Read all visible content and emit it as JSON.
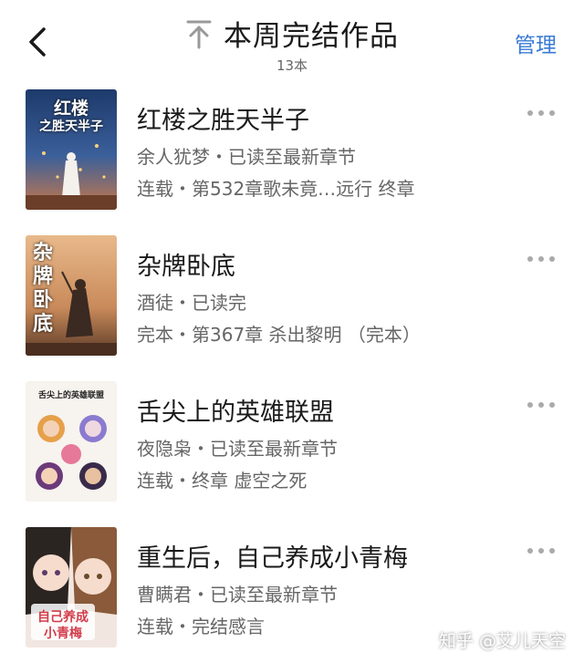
{
  "header": {
    "title": "本周完结作品",
    "count": "13本",
    "manage_label": "管理"
  },
  "icons": {
    "back": "chevron-left-icon",
    "top": "arrow-up-to-top-icon",
    "more": "more-horizontal-icon"
  },
  "colors": {
    "accent": "#3a7bd5",
    "text": "#1a1a1a",
    "secondary": "#666666"
  },
  "books": [
    {
      "title": "红楼之胜天半子",
      "meta": "余人犹梦・已读至最新章节",
      "progress": "连载・第532章歌未竟…远行 终章",
      "cover_text_1": "红楼",
      "cover_text_2": "之胜天半子"
    },
    {
      "title": "杂牌卧底",
      "meta": "酒徒・已读完",
      "progress": "完本・第367章 杀出黎明 （完本）",
      "cover_text_1": "杂牌",
      "cover_text_2": "卧底"
    },
    {
      "title": "舌尖上的英雄联盟",
      "meta": "夜隐枭・已读至最新章节",
      "progress": "连载・终章 虚空之死",
      "cover_text_1": "舌尖上的英雄联盟"
    },
    {
      "title": "重生后，自己养成小青梅",
      "meta": "曹瞒君・已读至最新章节",
      "progress": "连载・完结感言",
      "cover_text_1": "自己养成",
      "cover_text_2": "小青梅"
    }
  ],
  "watermark": "知乎 @艾儿天空"
}
